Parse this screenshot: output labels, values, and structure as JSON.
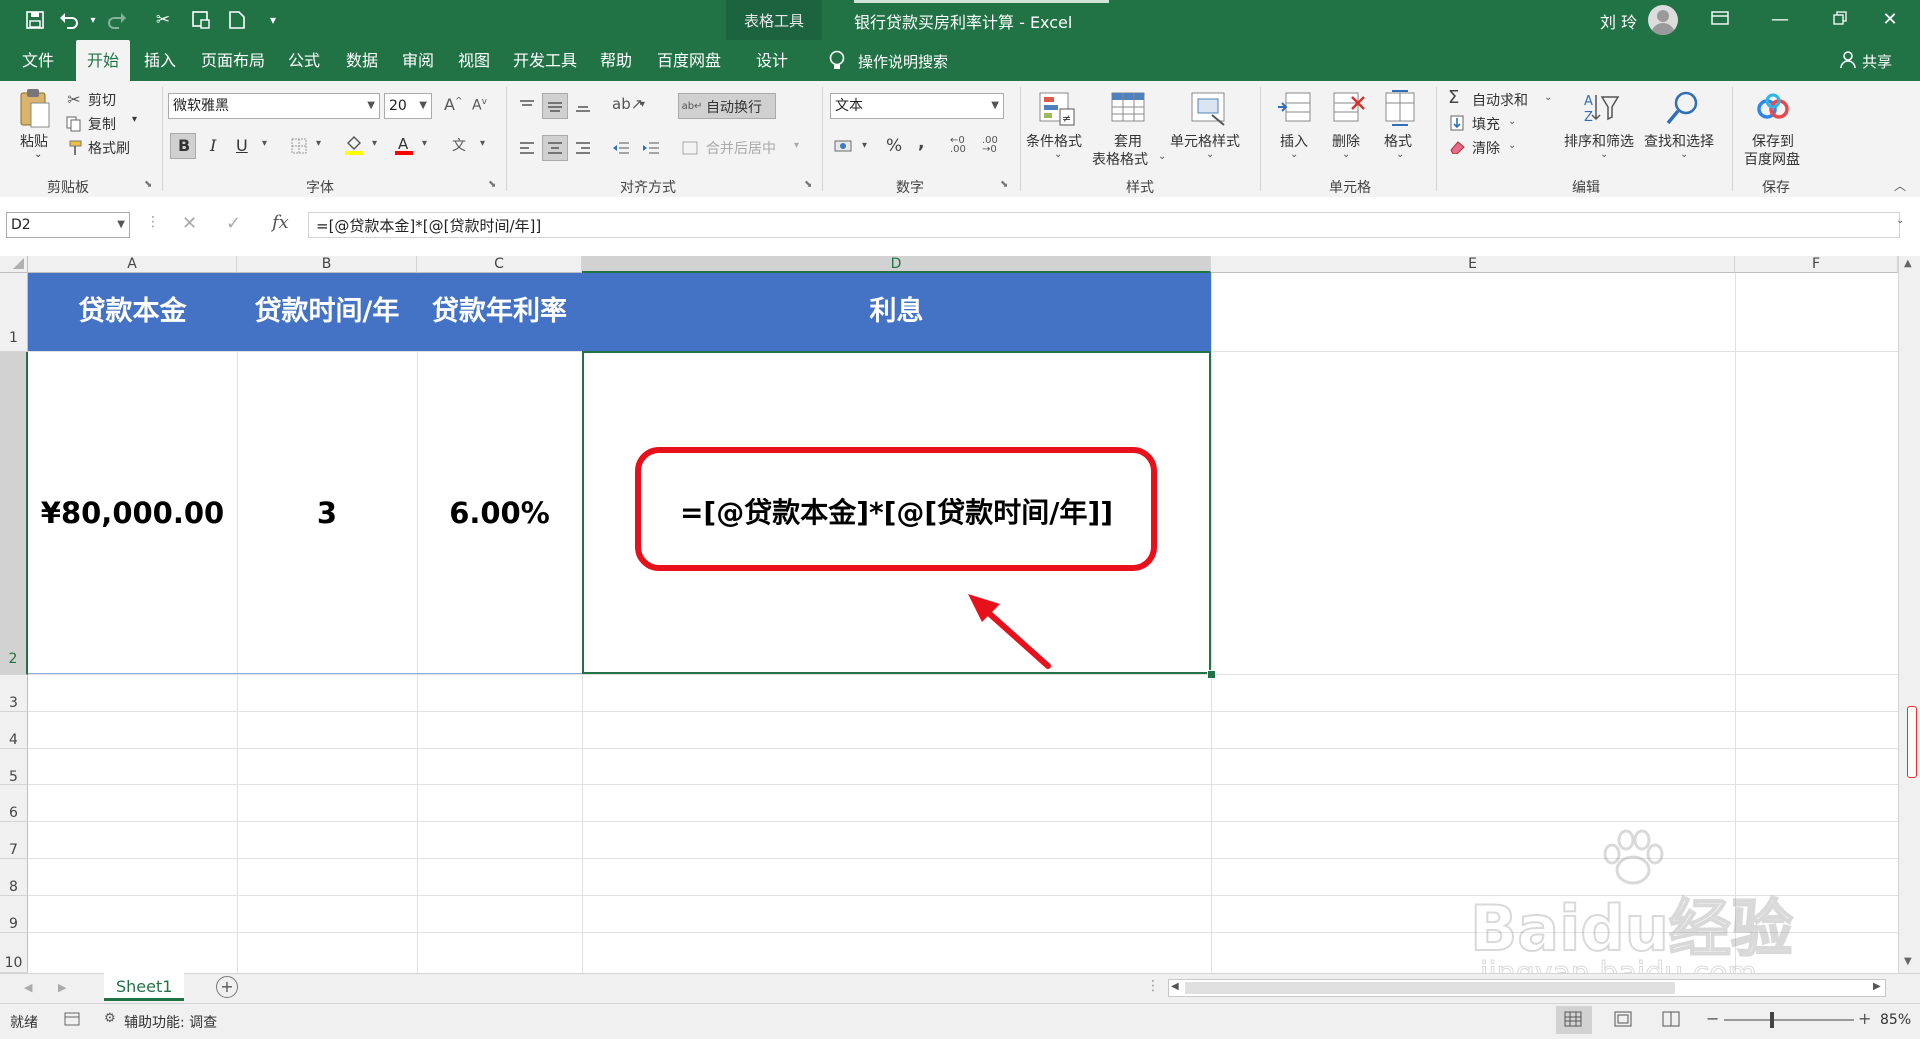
{
  "title_bar": {
    "context_tab": "表格工具",
    "doc_title": "银行贷款买房利率计算  -  Excel",
    "user_name": "刘 玲"
  },
  "ribbon_tabs": [
    "文件",
    "开始",
    "插入",
    "页面布局",
    "公式",
    "数据",
    "审阅",
    "视图",
    "开发工具",
    "帮助",
    "百度网盘",
    "设计"
  ],
  "active_tab": "开始",
  "tell_me": "操作说明搜索",
  "share": "共享",
  "clipboard": {
    "paste": "粘贴",
    "cut": "剪切",
    "copy": "复制",
    "format_painter": "格式刷",
    "group": "剪贴板"
  },
  "font": {
    "name": "微软雅黑",
    "size": "20",
    "bold": "B",
    "italic": "I",
    "underline": "U",
    "group": "字体"
  },
  "alignment": {
    "wrap_text": "自动换行",
    "merge_center": "合并后居中",
    "group": "对齐方式"
  },
  "number": {
    "format": "文本",
    "percent": "%",
    "comma": ",",
    "group": "数字"
  },
  "styles": {
    "conditional": "条件格式",
    "table_format_line1": "套用",
    "table_format_line2": "表格格式",
    "cell_styles": "单元格样式",
    "group": "样式"
  },
  "cells": {
    "insert": "插入",
    "delete": "删除",
    "format": "格式",
    "group": "单元格"
  },
  "editing": {
    "autosum": "自动求和",
    "fill": "填充",
    "clear": "清除",
    "sort_filter": "排序和筛选",
    "find_select": "查找和选择",
    "group": "编辑"
  },
  "save_group": {
    "save_line1": "保存到",
    "save_line2": "百度网盘",
    "group": "保存"
  },
  "formula_bar": {
    "name_box": "D2",
    "fx": "fx",
    "formula": "=[@贷款本金]*[@[贷款时间/年]]"
  },
  "columns": [
    "A",
    "B",
    "C",
    "D",
    "E",
    "F"
  ],
  "rows": [
    "1",
    "2",
    "3",
    "4",
    "5",
    "6",
    "7",
    "8",
    "9",
    "10"
  ],
  "table": {
    "headers": [
      "贷款本金",
      "贷款时间/年",
      "贷款年利率",
      "利息"
    ],
    "row": [
      "¥80,000.00",
      "3",
      "6.00%",
      "=[@贷款本金]*[@[贷款时间/年]]"
    ]
  },
  "sheet_tab": "Sheet1",
  "status": {
    "ready": "就绪",
    "accessibility": "辅助功能: 调查",
    "zoom": "85%"
  },
  "watermark": {
    "brand": "Baidu经验",
    "url": "jingyan.baidu.com"
  },
  "colors": {
    "excel_green": "#217346",
    "table_header": "#4472c4",
    "highlight_red": "#e8101a"
  }
}
